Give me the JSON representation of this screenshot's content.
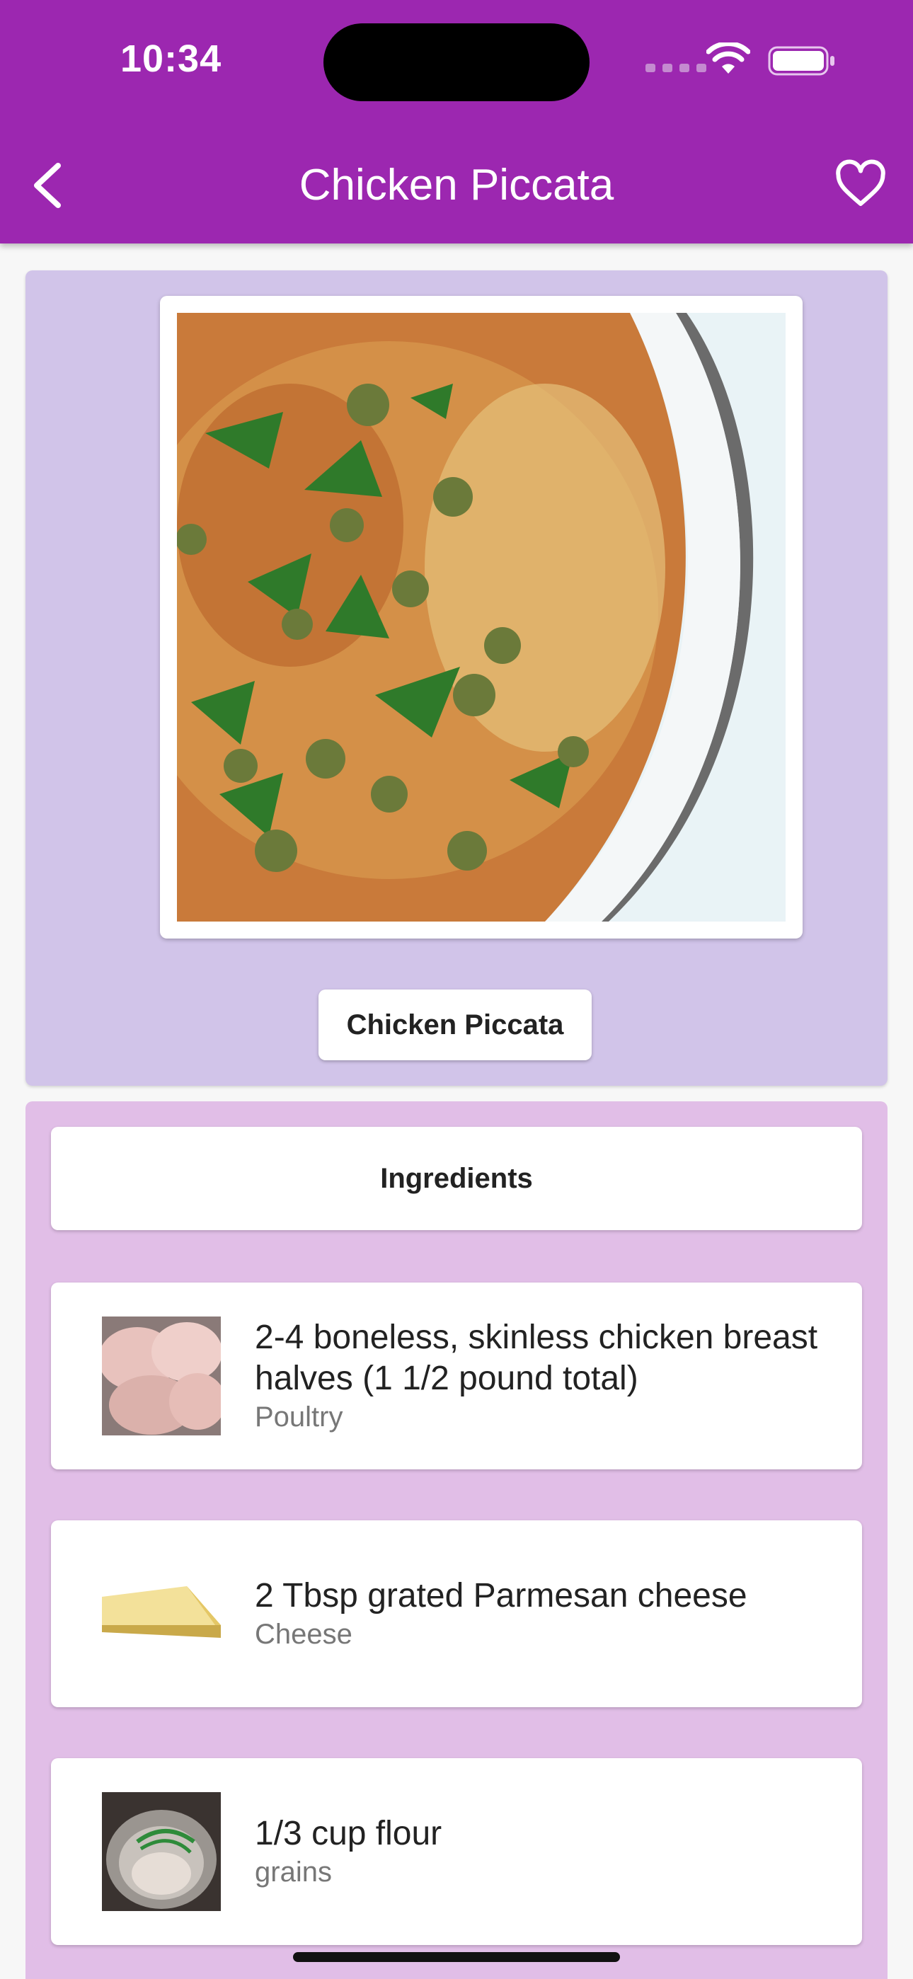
{
  "status_bar": {
    "time": "10:34"
  },
  "app_bar": {
    "title": "Chicken Piccata"
  },
  "recipe": {
    "name": "Chicken Piccata"
  },
  "ingredients": {
    "header": "Ingredients",
    "items": [
      {
        "name": "2-4 boneless, skinless chicken breast halves (1 1/2 pound total)",
        "category": "Poultry"
      },
      {
        "name": "2 Tbsp grated Parmesan cheese",
        "category": "Cheese"
      },
      {
        "name": "1/3 cup flour",
        "category": "grains"
      }
    ]
  },
  "colors": {
    "app_bar": "#9c27b0",
    "hero_card": "#d1c4e9",
    "ingredients_section": "#e1bee7"
  },
  "icons": [
    "back-arrow-icon",
    "heart-icon",
    "wifi-icon",
    "battery-icon",
    "signal-icon"
  ]
}
